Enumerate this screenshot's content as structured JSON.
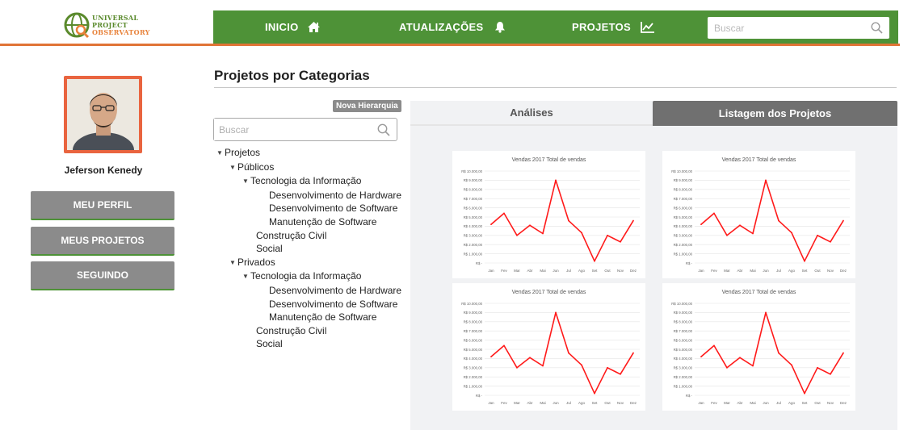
{
  "logo": {
    "line1": "UNIVERSAL",
    "line2": "PROJECT",
    "line3": "OBSERVATORY"
  },
  "nav": {
    "items": [
      {
        "label": "INICIO",
        "icon": "home-icon"
      },
      {
        "label": "ATUALIZAÇÕES",
        "icon": "bell-icon"
      },
      {
        "label": "PROJETOS",
        "icon": "line-chart-icon"
      }
    ],
    "search_placeholder": "Buscar"
  },
  "colors": {
    "nav_green": "#4e9237",
    "accent_orange": "#e07436",
    "button_gray": "#8b8b8b",
    "line_red": "#ff1a1a"
  },
  "sidebar": {
    "user_name": "Jeferson Kenedy",
    "buttons": [
      "MEU PERFIL",
      "MEUS PROJETOS",
      "SEGUINDO"
    ]
  },
  "main": {
    "title": "Projetos por Categorias",
    "badge": "Nova Hierarquia",
    "tree_search_placeholder": "Buscar",
    "tree": {
      "root": "Projetos",
      "publicos": "Públicos",
      "pub_ti": "Tecnologia da Informação",
      "pub_ti_1": "Desenvolvimento de Hardware",
      "pub_ti_2": "Desenvolvimento de Software",
      "pub_ti_3": "Manutenção de Software",
      "pub_cc": "Construção Civil",
      "pub_social": "Social",
      "privados": "Privados",
      "priv_ti": "Tecnologia da Informação",
      "priv_ti_1": "Desenvolvimento de Hardware",
      "priv_ti_2": "Desenvolvimento de Software",
      "priv_ti_3": "Manutenção de Software",
      "priv_cc": "Construção Civil",
      "priv_social": "Social"
    },
    "tabs": [
      {
        "label": "Análises",
        "active": false
      },
      {
        "label": "Listagem dos Projetos",
        "active": true
      }
    ]
  },
  "chart_data": [
    {
      "type": "line",
      "title": "Vendas 2017 Total de vendas",
      "categories": [
        "Jan",
        "Fev",
        "Mar",
        "Abr",
        "Mai",
        "Jun",
        "Jul",
        "Ago",
        "Set",
        "Out",
        "Nov",
        "Dez"
      ],
      "values": [
        4200,
        5400,
        3000,
        4100,
        3200,
        9000,
        4600,
        3300,
        200,
        3000,
        2300,
        4600
      ],
      "ytick_labels": [
        "R$ 10.000,00",
        "R$ 9.000,00",
        "R$ 8.000,00",
        "R$ 7.000,00",
        "R$ 6.000,00",
        "R$ 5.000,00",
        "R$ 4.000,00",
        "R$ 3.000,00",
        "R$ 2.000,00",
        "R$ 1.000,00",
        "R$ -"
      ],
      "ylim": [
        0,
        10000
      ]
    },
    {
      "type": "line",
      "title": "Vendas 2017 Total de vendas",
      "categories": [
        "Jan",
        "Fev",
        "Mar",
        "Abr",
        "Mai",
        "Jun",
        "Jul",
        "Ago",
        "Set",
        "Out",
        "Nov",
        "Dez"
      ],
      "values": [
        4200,
        5400,
        3000,
        4100,
        3200,
        9000,
        4600,
        3300,
        200,
        3000,
        2300,
        4600
      ],
      "ytick_labels": [
        "R$ 10.000,00",
        "R$ 9.000,00",
        "R$ 8.000,00",
        "R$ 7.000,00",
        "R$ 6.000,00",
        "R$ 5.000,00",
        "R$ 4.000,00",
        "R$ 3.000,00",
        "R$ 2.000,00",
        "R$ 1.000,00",
        "R$ -"
      ],
      "ylim": [
        0,
        10000
      ]
    },
    {
      "type": "line",
      "title": "Vendas 2017 Total de vendas",
      "categories": [
        "Jan",
        "Fev",
        "Mar",
        "Abr",
        "Mai",
        "Jun",
        "Jul",
        "Ago",
        "Set",
        "Out",
        "Nov",
        "Dez"
      ],
      "values": [
        4200,
        5400,
        3000,
        4100,
        3200,
        9000,
        4600,
        3300,
        200,
        3000,
        2300,
        4600
      ],
      "ytick_labels": [
        "R$ 10.000,00",
        "R$ 9.000,00",
        "R$ 8.000,00",
        "R$ 7.000,00",
        "R$ 6.000,00",
        "R$ 5.000,00",
        "R$ 4.000,00",
        "R$ 3.000,00",
        "R$ 2.000,00",
        "R$ 1.000,00",
        "R$ -"
      ],
      "ylim": [
        0,
        10000
      ]
    },
    {
      "type": "line",
      "title": "Vendas 2017 Total de vendas",
      "categories": [
        "Jan",
        "Fev",
        "Mar",
        "Abr",
        "Mai",
        "Jun",
        "Jul",
        "Ago",
        "Set",
        "Out",
        "Nov",
        "Dez"
      ],
      "values": [
        4200,
        5400,
        3000,
        4100,
        3200,
        9000,
        4600,
        3300,
        200,
        3000,
        2300,
        4600
      ],
      "ytick_labels": [
        "R$ 10.000,00",
        "R$ 9.000,00",
        "R$ 8.000,00",
        "R$ 7.000,00",
        "R$ 6.000,00",
        "R$ 5.000,00",
        "R$ 4.000,00",
        "R$ 3.000,00",
        "R$ 2.000,00",
        "R$ 1.000,00",
        "R$ -"
      ],
      "ylim": [
        0,
        10000
      ]
    }
  ]
}
